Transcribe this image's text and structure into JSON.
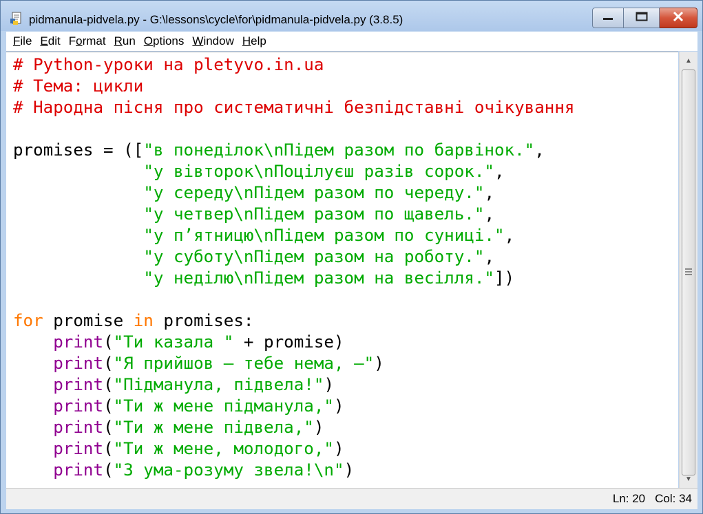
{
  "window": {
    "title": "pidmanula-pidvela.py - G:\\lessons\\cycle\\for\\pidmanula-pidvela.py (3.8.5)"
  },
  "menu": {
    "items": [
      {
        "u": "F",
        "rest": "ile"
      },
      {
        "u": "E",
        "rest": "dit"
      },
      {
        "pre": "F",
        "u": "o",
        "rest": "rmat"
      },
      {
        "u": "R",
        "rest": "un"
      },
      {
        "u": "O",
        "rest": "ptions"
      },
      {
        "u": "W",
        "rest": "indow"
      },
      {
        "u": "H",
        "rest": "elp"
      }
    ]
  },
  "code": {
    "lines": [
      [
        {
          "t": "# Python-уроки на pletyvo.in.ua",
          "c": "comment"
        }
      ],
      [
        {
          "t": "# Тема: цикли",
          "c": "comment"
        }
      ],
      [
        {
          "t": "# Народна пісня про систематичні безпідставні очікування",
          "c": "comment"
        }
      ],
      [],
      [
        {
          "t": "promises = ([",
          "c": ""
        },
        {
          "t": "\"в понеділок\\nПідем разом по барвінок.\"",
          "c": "string"
        },
        {
          "t": ",",
          "c": ""
        }
      ],
      [
        {
          "t": "             ",
          "c": ""
        },
        {
          "t": "\"у вівторок\\nПоцілуєш разів сорок.\"",
          "c": "string"
        },
        {
          "t": ",",
          "c": ""
        }
      ],
      [
        {
          "t": "             ",
          "c": ""
        },
        {
          "t": "\"у середу\\nПідем разом по череду.\"",
          "c": "string"
        },
        {
          "t": ",",
          "c": ""
        }
      ],
      [
        {
          "t": "             ",
          "c": ""
        },
        {
          "t": "\"у четвер\\nПідем разом по щавель.\"",
          "c": "string"
        },
        {
          "t": ",",
          "c": ""
        }
      ],
      [
        {
          "t": "             ",
          "c": ""
        },
        {
          "t": "\"у п’ятницю\\nПідем разом по суниці.\"",
          "c": "string"
        },
        {
          "t": ",",
          "c": ""
        }
      ],
      [
        {
          "t": "             ",
          "c": ""
        },
        {
          "t": "\"у суботу\\nПідем разом на роботу.\"",
          "c": "string"
        },
        {
          "t": ",",
          "c": ""
        }
      ],
      [
        {
          "t": "             ",
          "c": ""
        },
        {
          "t": "\"у неділю\\nПідем разом на весілля.\"",
          "c": "string"
        },
        {
          "t": "])",
          "c": ""
        }
      ],
      [],
      [
        {
          "t": "for",
          "c": "keyword"
        },
        {
          "t": " promise ",
          "c": ""
        },
        {
          "t": "in",
          "c": "keyword"
        },
        {
          "t": " promises:",
          "c": ""
        }
      ],
      [
        {
          "t": "    ",
          "c": ""
        },
        {
          "t": "print",
          "c": "builtin"
        },
        {
          "t": "(",
          "c": ""
        },
        {
          "t": "\"Ти казала \"",
          "c": "string"
        },
        {
          "t": " + promise)",
          "c": ""
        }
      ],
      [
        {
          "t": "    ",
          "c": ""
        },
        {
          "t": "print",
          "c": "builtin"
        },
        {
          "t": "(",
          "c": ""
        },
        {
          "t": "\"Я прийшов – тебе нема, –\"",
          "c": "string"
        },
        {
          "t": ")",
          "c": ""
        }
      ],
      [
        {
          "t": "    ",
          "c": ""
        },
        {
          "t": "print",
          "c": "builtin"
        },
        {
          "t": "(",
          "c": ""
        },
        {
          "t": "\"Підманула, підвела!\"",
          "c": "string"
        },
        {
          "t": ")",
          "c": ""
        }
      ],
      [
        {
          "t": "    ",
          "c": ""
        },
        {
          "t": "print",
          "c": "builtin"
        },
        {
          "t": "(",
          "c": ""
        },
        {
          "t": "\"Ти ж мене підманула,\"",
          "c": "string"
        },
        {
          "t": ")",
          "c": ""
        }
      ],
      [
        {
          "t": "    ",
          "c": ""
        },
        {
          "t": "print",
          "c": "builtin"
        },
        {
          "t": "(",
          "c": ""
        },
        {
          "t": "\"Ти ж мене підвела,\"",
          "c": "string"
        },
        {
          "t": ")",
          "c": ""
        }
      ],
      [
        {
          "t": "    ",
          "c": ""
        },
        {
          "t": "print",
          "c": "builtin"
        },
        {
          "t": "(",
          "c": ""
        },
        {
          "t": "\"Ти ж мене, молодого,\"",
          "c": "string"
        },
        {
          "t": ")",
          "c": ""
        }
      ],
      [
        {
          "t": "    ",
          "c": ""
        },
        {
          "t": "print",
          "c": "builtin"
        },
        {
          "t": "(",
          "c": ""
        },
        {
          "t": "\"З ума-розуму звела!\\n\"",
          "c": "string"
        },
        {
          "t": ")",
          "c": ""
        }
      ]
    ]
  },
  "status": {
    "line": "Ln: 20",
    "col": "Col: 34"
  },
  "colors": {
    "comment": "#dd0000",
    "string": "#00aa00",
    "keyword": "#ff7700",
    "builtin": "#900090"
  },
  "icons": {
    "app": "idle-python-file-icon",
    "minimize": "minimize-icon",
    "maximize": "maximize-icon",
    "close": "close-icon"
  }
}
